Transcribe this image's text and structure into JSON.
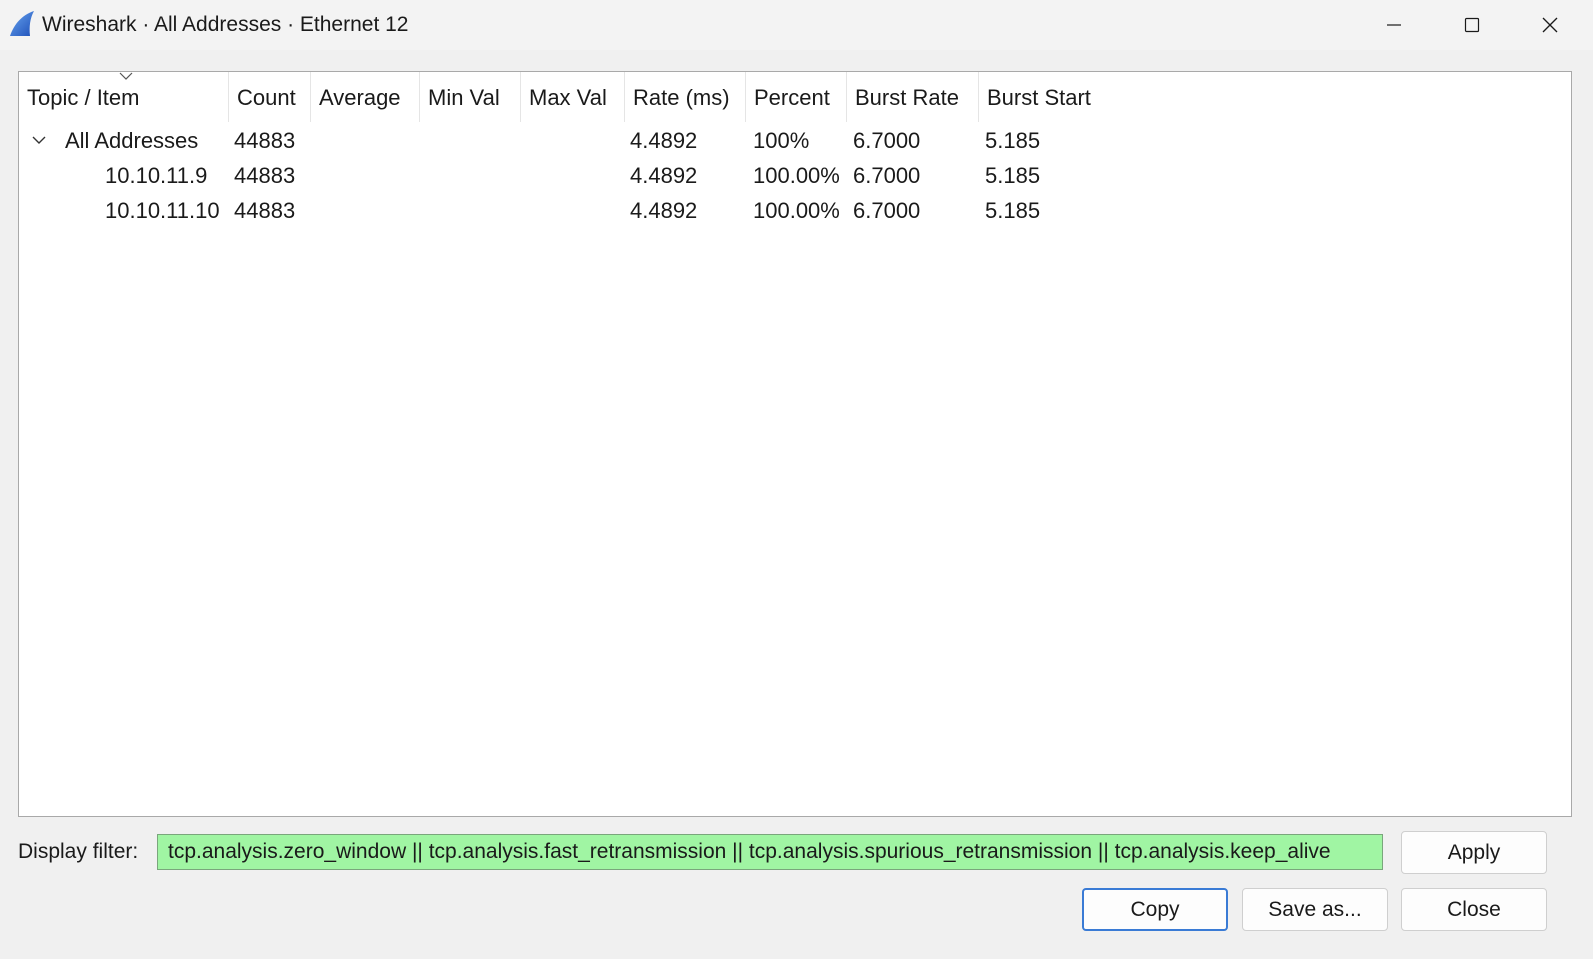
{
  "window": {
    "title": "Wireshark · All Addresses · Ethernet 12",
    "icon": "wireshark-fin-icon",
    "controls": [
      "minimize-icon",
      "maximize-icon",
      "close-icon"
    ]
  },
  "table": {
    "columns": [
      "Topic / Item",
      "Count",
      "Average",
      "Min Val",
      "Max Val",
      "Rate (ms)",
      "Percent",
      "Burst Rate",
      "Burst Start"
    ],
    "sorted_column": "Topic / Item",
    "rows": [
      {
        "topic": "All Addresses",
        "count": "44883",
        "average": "",
        "min_val": "",
        "max_val": "",
        "rate": "4.4892",
        "percent": "100%",
        "burst_rate": "6.7000",
        "burst_start": "5.185",
        "expanded": true
      },
      {
        "topic": "10.10.11.9",
        "count": "44883",
        "average": "",
        "min_val": "",
        "max_val": "",
        "rate": "4.4892",
        "percent": "100.00%",
        "burst_rate": "6.7000",
        "burst_start": "5.185"
      },
      {
        "topic": "10.10.11.10",
        "count": "44883",
        "average": "",
        "min_val": "",
        "max_val": "",
        "rate": "4.4892",
        "percent": "100.00%",
        "burst_rate": "6.7000",
        "burst_start": "5.185"
      }
    ]
  },
  "filter": {
    "label": "Display filter:",
    "value": "tcp.analysis.zero_window || tcp.analysis.fast_retransmission || tcp.analysis.spurious_retransmission || tcp.analysis.keep_alive",
    "valid_color": "#a0f5a3"
  },
  "buttons": {
    "apply": "Apply",
    "copy": "Copy",
    "save_as": "Save as...",
    "close": "Close"
  },
  "colors": {
    "accent": "#3a7bd5"
  }
}
